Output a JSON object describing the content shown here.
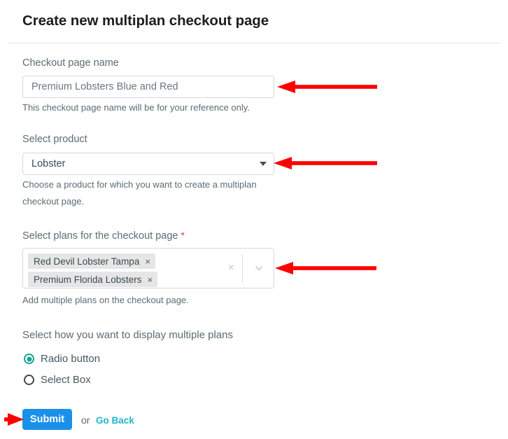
{
  "header": {
    "title": "Create new multiplan checkout page"
  },
  "form": {
    "checkout_name": {
      "label": "Checkout page name",
      "value": "Premium Lobsters Blue and Red",
      "placeholder": "Premium Lobsters Blue and Red",
      "help": "This checkout page name will be for your reference only."
    },
    "product": {
      "label": "Select product",
      "selected": "Lobster",
      "help_line1": "Choose a product for which you want to create a multiplan",
      "help_line2": "checkout page.",
      "caret_icon": "caret-down-icon"
    },
    "plans": {
      "label": "Select plans for the checkout page",
      "required_marker": "*",
      "tags": [
        {
          "label": "Red Devil Lobster Tampa",
          "remove_icon": "×"
        },
        {
          "label": "Premium Florida Lobsters",
          "remove_icon": "×"
        }
      ],
      "clear_icon": "×",
      "dropdown_icon": "chevron-down-icon",
      "help": "Add multiple plans on the checkout page."
    },
    "display_mode": {
      "label": "Select how you want to display multiple plans",
      "options": [
        {
          "label": "Radio button",
          "selected": true
        },
        {
          "label": "Select Box",
          "selected": false
        }
      ]
    },
    "actions": {
      "submit_label": "Submit",
      "or_label": "or",
      "go_back_label": "Go Back"
    }
  },
  "annotations": {
    "arrow_color": "#fe0000",
    "arrows": [
      {
        "name": "arrow-to-name-input",
        "direction": "left"
      },
      {
        "name": "arrow-to-product-select",
        "direction": "left"
      },
      {
        "name": "arrow-to-plans-multiselect",
        "direction": "left"
      },
      {
        "name": "arrow-to-submit-button",
        "direction": "right"
      }
    ]
  },
  "colors": {
    "submit_blue": "#1b90e8",
    "link_teal": "#1fb6c8",
    "radio_teal": "#16a394",
    "required_red": "#e03b3b",
    "label_gray": "#5c6b73"
  }
}
